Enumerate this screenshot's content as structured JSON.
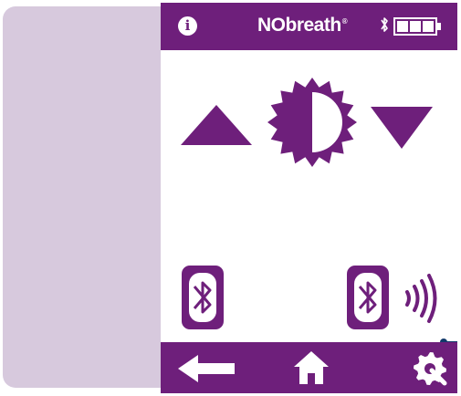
{
  "app": {
    "brand_name": "NObreath",
    "brand_mark": "®"
  },
  "colors": {
    "primary": "#6e1f7b",
    "panel": "#d7c9dd",
    "callout": "#12396a"
  },
  "top_bar": {
    "icons": [
      "info-icon",
      "bluetooth-icon",
      "battery-icon"
    ],
    "info_glyph": "i"
  },
  "content": {
    "controls": [
      "brightness-up-arrow-icon",
      "brightness-sun-icon",
      "brightness-down-arrow-icon"
    ],
    "bluetooth": [
      "bluetooth-icon",
      "bluetooth-signal-icon"
    ]
  },
  "bottom_bar": {
    "icons": [
      "back-arrow-icon",
      "home-icon",
      "settings-icon"
    ]
  }
}
